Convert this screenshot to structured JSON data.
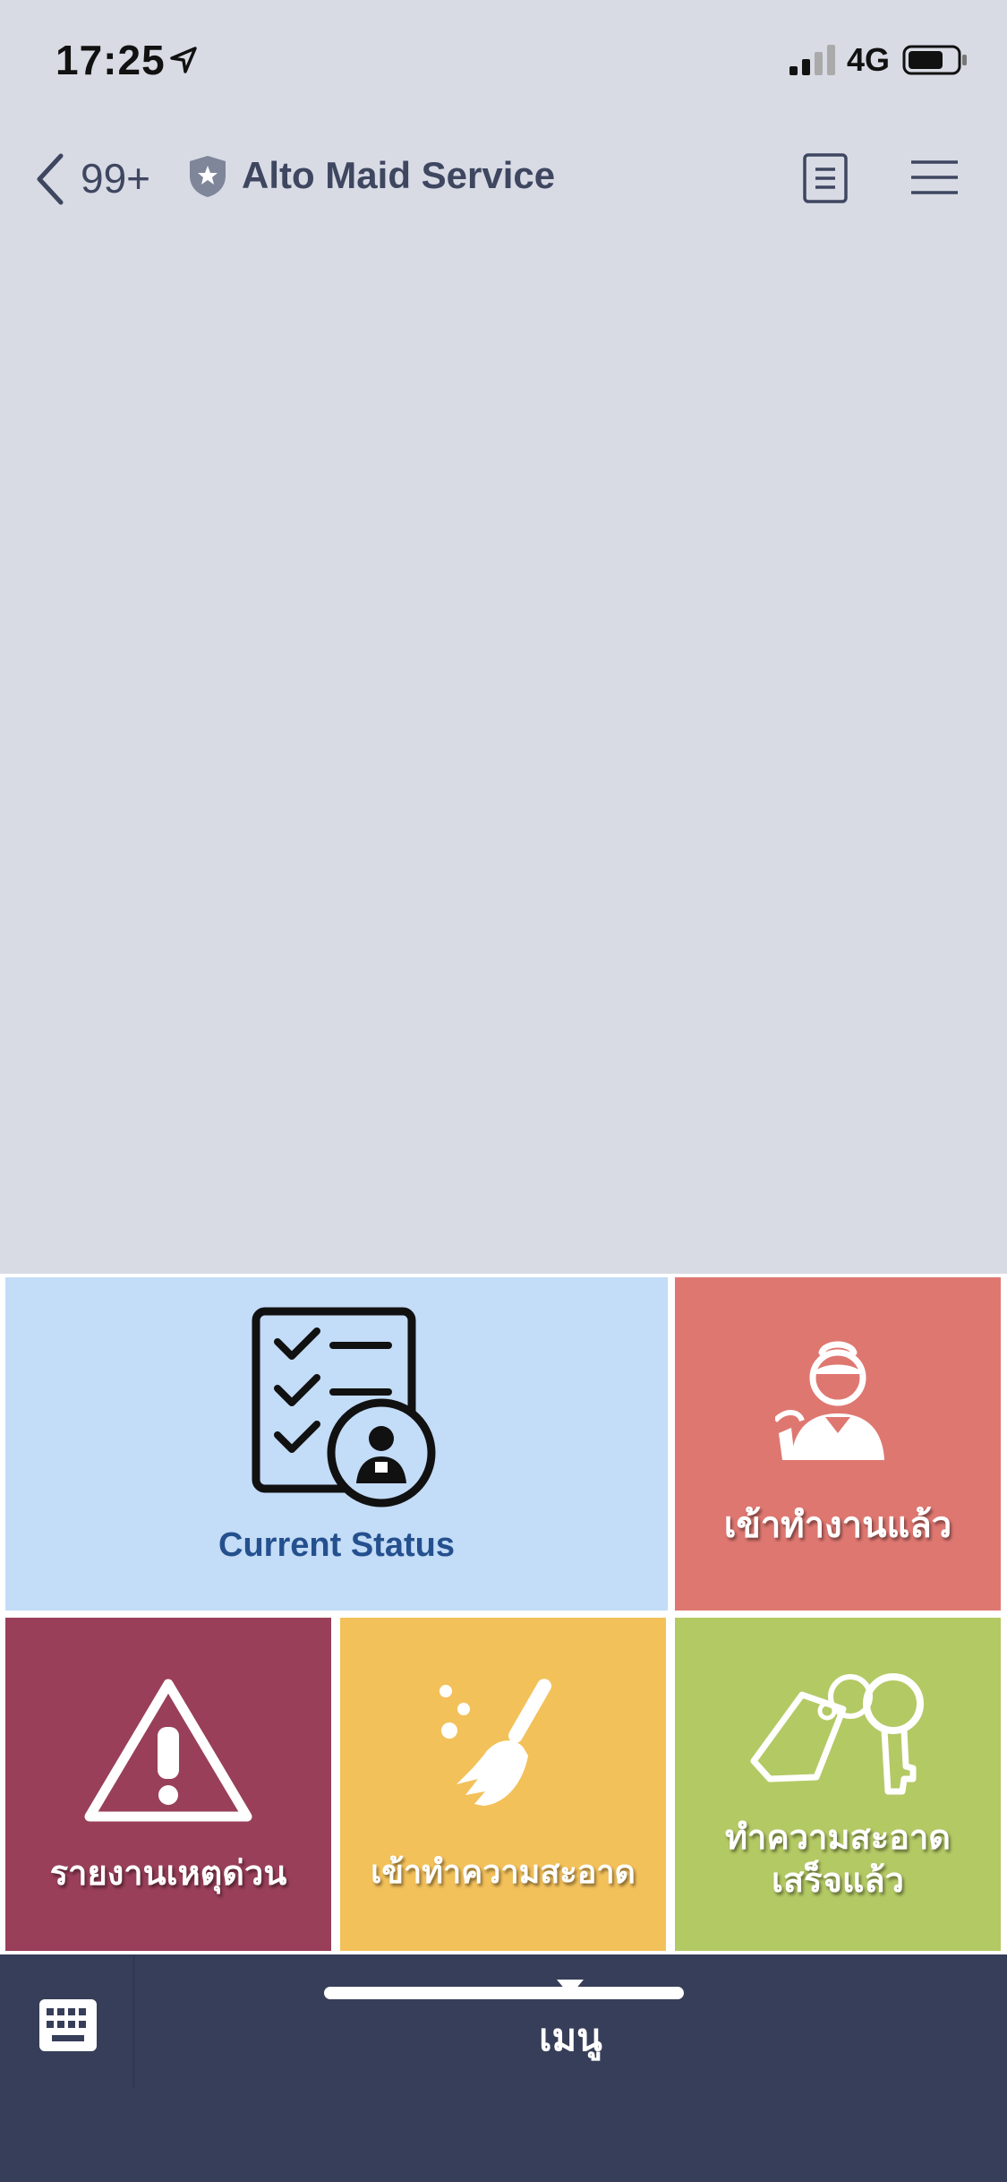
{
  "status_bar": {
    "time": "17:25",
    "network": "4G"
  },
  "header": {
    "back_count": "99+",
    "title": "Alto Maid Service"
  },
  "rich_menu": {
    "current_status": "Current Status",
    "check_in_work": "เข้าทำงานแล้ว",
    "urgent_report": "รายงานเหตุด่วน",
    "start_cleaning": "เข้าทำความสะอาด",
    "cleaning_done_line1": "ทำความสะอาด",
    "cleaning_done_line2": "เสร็จแล้ว"
  },
  "bottom_bar": {
    "menu_label": "เมนู"
  },
  "colors": {
    "background": "#d8dbe4",
    "current_status_tile": "#c3dcf7",
    "check_in_tile": "#df7771",
    "urgent_tile": "#993f59",
    "cleaning_tile": "#f3c15a",
    "done_tile": "#b3c964",
    "bottom_bar": "#373e59"
  },
  "icons": {
    "status": [
      "location-arrow-icon",
      "signal-icon",
      "battery-icon"
    ],
    "header": [
      "back-chevron-icon",
      "shield-star-icon",
      "notes-icon",
      "hamburger-menu-icon"
    ],
    "tiles": [
      "checklist-maid-icon",
      "maid-icon",
      "warning-icon",
      "broom-icon",
      "keys-tag-icon"
    ],
    "bottom": [
      "keyboard-icon",
      "caret-down-icon"
    ]
  }
}
